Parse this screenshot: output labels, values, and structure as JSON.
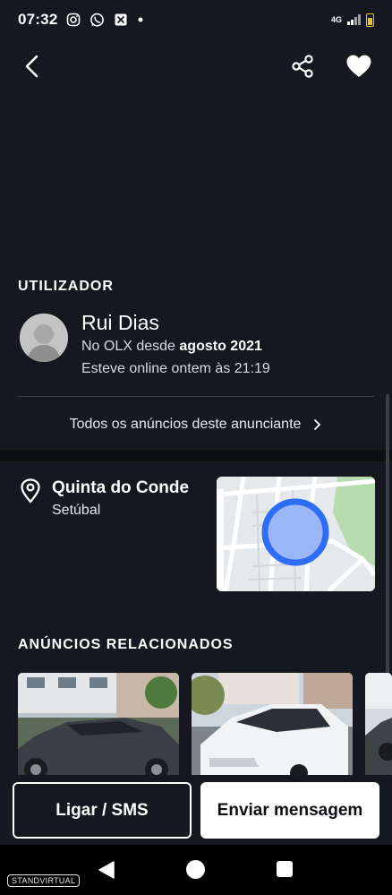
{
  "status_bar": {
    "time": "07:32",
    "network": "4G",
    "icons": [
      "instagram-icon",
      "whatsapp-icon",
      "app-notification-icon",
      "dot-icon"
    ],
    "battery_color": "#f0c419"
  },
  "header": {
    "back_icon": "chevron-left-icon",
    "share_icon": "share-icon",
    "favorite_icon": "heart-icon"
  },
  "user_section": {
    "title": "UTILIZADOR",
    "name": "Rui Dias",
    "since_prefix": "No OLX desde ",
    "since_date": "agosto 2021",
    "last_online": "Esteve online ontem às 21:19",
    "all_ads_link": "Todos os anúncios deste anunciante"
  },
  "location": {
    "city": "Quinta do Conde",
    "region": "Setúbal",
    "map_accent": "#2e6df6"
  },
  "related": {
    "title": "ANÚNCIOS RELACIONADOS"
  },
  "actions": {
    "call_label": "Ligar / SMS",
    "message_label": "Enviar mensagem"
  },
  "nav_bar": {
    "watermark": "STANDVIRTUAL"
  },
  "colors": {
    "background": "#151820",
    "band": "#0d0f13",
    "text": "#ffffff"
  }
}
